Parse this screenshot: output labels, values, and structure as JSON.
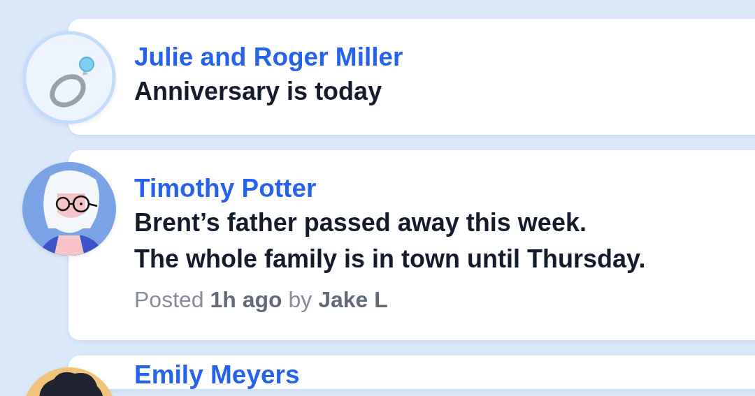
{
  "posts": [
    {
      "kind": "ring",
      "name": "Julie and Roger Miller",
      "message": "Anniversary is today"
    },
    {
      "kind": "elder",
      "name": "Timothy Potter",
      "message": "Brent’s father passed away this week.\nThe whole family is in town until Thursday.",
      "meta": "Posted **1h ago** by **Jake L**"
    },
    {
      "kind": "curly",
      "name": "Emily Meyers"
    }
  ]
}
